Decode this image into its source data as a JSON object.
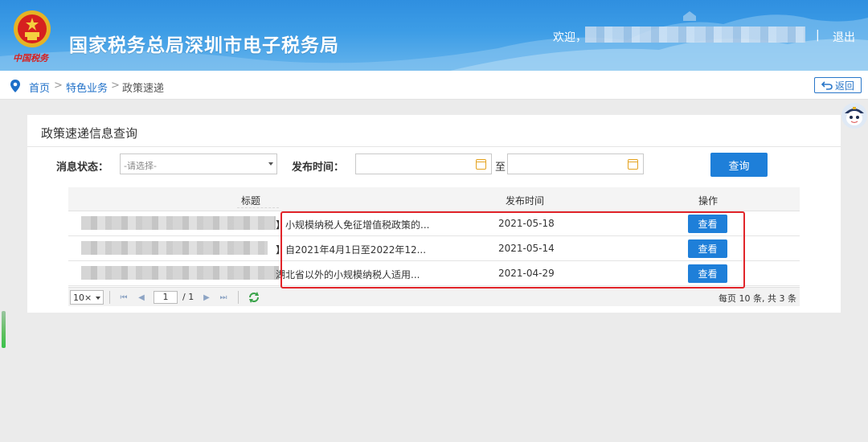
{
  "header": {
    "title": "国家税务总局深圳市电子税务局",
    "emblem_text": "中国税务",
    "welcome": "欢迎，",
    "separator": "|",
    "logout": "退出"
  },
  "breadcrumb": {
    "home": "首页",
    "sep": ">",
    "section": "特色业务",
    "current": "政策速递"
  },
  "back_button": "返回",
  "panel": {
    "title": "政策速递信息查询",
    "status_label": "消息状态：",
    "status_placeholder": "-请选择-",
    "date_label": "发布时间：",
    "to_text": "至",
    "query_button": "查询"
  },
  "table": {
    "columns": [
      "标题",
      "发布时间",
      "操作"
    ],
    "rows": [
      {
        "title": "】小规模纳税人免征增值税政策的...",
        "date": "2021-05-18",
        "action": "查看"
      },
      {
        "title": "】自2021年4月1日至2022年12...",
        "date": "2021-05-14",
        "action": "查看"
      },
      {
        "title": "湖北省以外的小规模纳税人适用...",
        "date": "2021-04-29",
        "action": "查看"
      }
    ]
  },
  "pager": {
    "page_size": "10",
    "page_size_suffix": "×",
    "current_page": "1",
    "total_pages": "/ 1",
    "info": "每页 10 条, 共 3 条"
  },
  "colors": {
    "header": "#3d9de6",
    "primary_button": "#1e7fd9",
    "link": "#1e6fc8",
    "highlight": "#e1252a"
  }
}
